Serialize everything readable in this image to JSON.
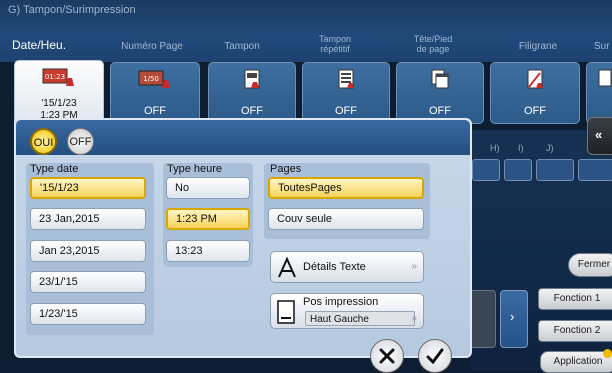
{
  "window": {
    "title": "G) Tampon/Surimpression"
  },
  "tabs": [
    {
      "label": "Date/Heu."
    },
    {
      "label": "Numéro Page"
    },
    {
      "label": "Tampon"
    },
    {
      "label": "Tampon répétitif"
    },
    {
      "label": "Tête/Pied de page"
    },
    {
      "label": "Filigrane"
    },
    {
      "label": "Sur"
    }
  ],
  "cards": [
    {
      "icon": "date-stamp-icon",
      "value": "'15/1/23 1:23 PM"
    },
    {
      "icon": "page-number-icon",
      "value": "OFF"
    },
    {
      "icon": "stamp-icon",
      "value": "OFF"
    },
    {
      "icon": "repeat-stamp-icon",
      "value": "OFF"
    },
    {
      "icon": "header-footer-icon",
      "value": "OFF"
    },
    {
      "icon": "watermark-icon",
      "value": "OFF"
    }
  ],
  "toggle": {
    "on": "OUI",
    "off": "OFF"
  },
  "date_type": {
    "title": "Type date",
    "options": [
      "'15/1/23",
      "23 Jan,2015",
      "Jan 23,2015",
      "23/1/'15",
      "1/23/'15"
    ],
    "selected": 0
  },
  "time_type": {
    "title": "Type heure",
    "options": [
      "No",
      "1:23 PM",
      "13:23"
    ],
    "selected": 1
  },
  "pages": {
    "title": "Pages",
    "options": [
      "ToutesPages",
      "Couv seule"
    ],
    "selected": 0
  },
  "text_details": {
    "label": "Détails Texte"
  },
  "print_position": {
    "label": "Pos impression",
    "value": "Haut Gauche"
  },
  "background_letters": [
    "H)",
    "I)",
    "J)"
  ],
  "right": {
    "close": "Fermer",
    "function1": "Fonction 1",
    "function2": "Fonction 2",
    "application": "Application"
  },
  "colors": {
    "accent": "#f2c100",
    "panel": "#c4d4e8",
    "header": "#1f456f"
  }
}
